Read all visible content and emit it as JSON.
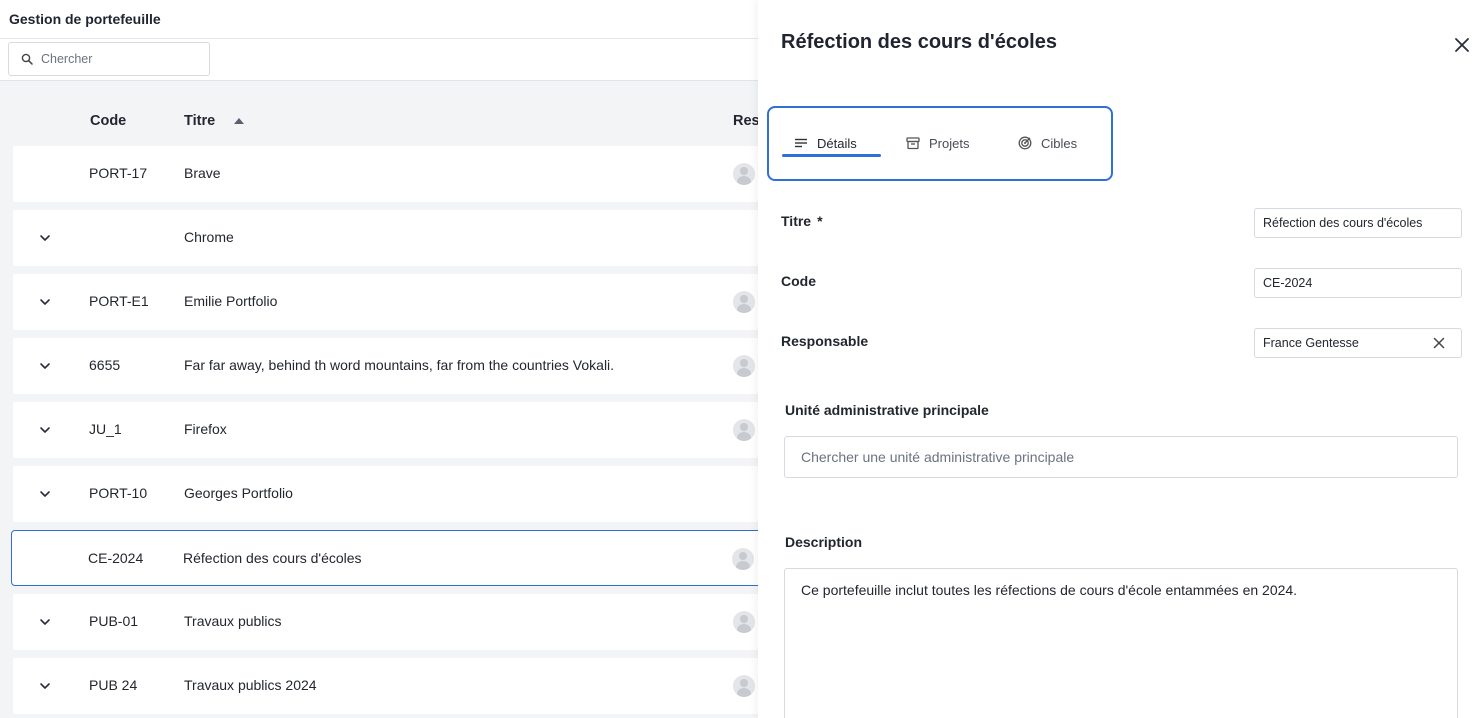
{
  "header": {
    "title": "Gestion de portefeuille"
  },
  "search": {
    "placeholder": "Chercher"
  },
  "table": {
    "columns": {
      "code": "Code",
      "title": "Titre",
      "responsible": "Res"
    },
    "rows": [
      {
        "code": "PORT-17",
        "title": "Brave",
        "expandable": false,
        "avatar": true
      },
      {
        "code": "",
        "title": "Chrome",
        "expandable": true,
        "avatar": false
      },
      {
        "code": "PORT-E1",
        "title": "Emilie Portfolio",
        "expandable": true,
        "avatar": true
      },
      {
        "code": "6655",
        "title": "Far far away, behind th word mountains, far from the countries Vokali.",
        "expandable": true,
        "avatar": true
      },
      {
        "code": "JU_1",
        "title": "Firefox",
        "expandable": true,
        "avatar": true
      },
      {
        "code": "PORT-10",
        "title": "Georges Portfolio",
        "expandable": true,
        "avatar": false
      },
      {
        "code": "CE-2024",
        "title": "Réfection des cours d'écoles",
        "expandable": false,
        "avatar": true,
        "selected": true
      },
      {
        "code": "PUB-01",
        "title": "Travaux publics",
        "expandable": true,
        "avatar": true
      },
      {
        "code": "PUB 24",
        "title": "Travaux publics 2024",
        "expandable": true,
        "avatar": true
      }
    ]
  },
  "drawer": {
    "title": "Réfection des cours d'écoles",
    "tabs": [
      {
        "label": "Détails",
        "icon": "lines-icon",
        "active": true
      },
      {
        "label": "Projets",
        "icon": "archive-icon",
        "active": false
      },
      {
        "label": "Cibles",
        "icon": "target-icon",
        "active": false
      }
    ],
    "fields": {
      "title_label": "Titre",
      "required_mark": "*",
      "title_value": "Réfection des cours d'écoles",
      "code_label": "Code",
      "code_value": "CE-2024",
      "responsible_label": "Responsable",
      "responsible_value": "France Gentesse",
      "unit_label": "Unité administrative principale",
      "unit_placeholder": "Chercher une unité administrative principale",
      "description_label": "Description",
      "description_value": "Ce portefeuille inclut toutes les réfections de cours d'école entammées en 2024."
    }
  },
  "colors": {
    "accent": "#2f6fd6",
    "background": "#f3f4f6"
  }
}
